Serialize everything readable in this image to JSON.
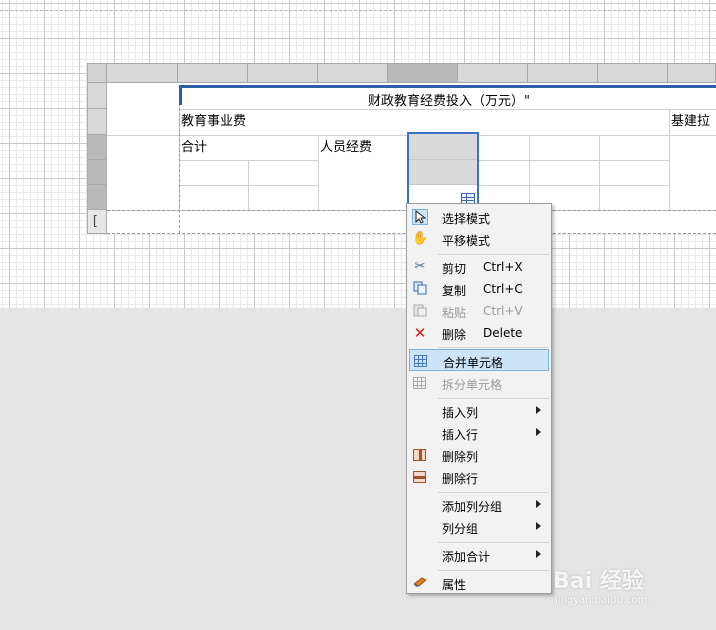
{
  "report": {
    "title": "财政教育经费投入（万元）\"",
    "header_row2": [
      "教育事业费",
      "基建拉"
    ],
    "header_row3": [
      "合计",
      "人员经费"
    ]
  },
  "context_menu": {
    "items": [
      {
        "id": "select-mode",
        "icon": "pointer-icon",
        "label": "选择模式",
        "shortcut": "",
        "submenu": false,
        "disabled": false
      },
      {
        "id": "pan-mode",
        "icon": "hand-icon",
        "label": "平移模式",
        "shortcut": "",
        "submenu": false,
        "disabled": false
      },
      {
        "id": "cut",
        "icon": "scissors-icon",
        "label": "剪切",
        "shortcut": "Ctrl+X",
        "submenu": false,
        "disabled": false
      },
      {
        "id": "copy",
        "icon": "copy-icon",
        "label": "复制",
        "shortcut": "Ctrl+C",
        "submenu": false,
        "disabled": false
      },
      {
        "id": "paste",
        "icon": "paste-icon",
        "label": "粘贴",
        "shortcut": "Ctrl+V",
        "submenu": false,
        "disabled": true
      },
      {
        "id": "delete",
        "icon": "delete-x-icon",
        "label": "删除",
        "shortcut": "Delete",
        "submenu": false,
        "disabled": false
      },
      {
        "id": "merge-cells",
        "icon": "merge-cells-icon",
        "label": "合并单元格",
        "shortcut": "",
        "submenu": false,
        "disabled": false,
        "highlighted": true
      },
      {
        "id": "split-cells",
        "icon": "split-cells-icon",
        "label": "拆分单元格",
        "shortcut": "",
        "submenu": false,
        "disabled": true
      },
      {
        "id": "insert-column",
        "icon": "",
        "label": "插入列",
        "shortcut": "",
        "submenu": true,
        "disabled": false
      },
      {
        "id": "insert-row",
        "icon": "",
        "label": "插入行",
        "shortcut": "",
        "submenu": true,
        "disabled": false
      },
      {
        "id": "delete-column",
        "icon": "delete-column-icon",
        "label": "删除列",
        "shortcut": "",
        "submenu": false,
        "disabled": false
      },
      {
        "id": "delete-row",
        "icon": "delete-row-icon",
        "label": "删除行",
        "shortcut": "",
        "submenu": false,
        "disabled": false
      },
      {
        "id": "add-column-group",
        "icon": "",
        "label": "添加列分组",
        "shortcut": "",
        "submenu": true,
        "disabled": false
      },
      {
        "id": "column-group",
        "icon": "",
        "label": "列分组",
        "shortcut": "",
        "submenu": true,
        "disabled": false
      },
      {
        "id": "add-total",
        "icon": "",
        "label": "添加合计",
        "shortcut": "",
        "submenu": true,
        "disabled": false
      },
      {
        "id": "properties",
        "icon": "properties-icon",
        "label": "属性",
        "shortcut": "",
        "submenu": false,
        "disabled": false
      }
    ]
  },
  "watermark": {
    "logo": "Bai 经验",
    "url": "jingyan.baidu.com"
  },
  "colors": {
    "selection_border": "#3a73c5",
    "menu_highlight": "#cce4f7",
    "title_border": "#2f5fa8"
  }
}
